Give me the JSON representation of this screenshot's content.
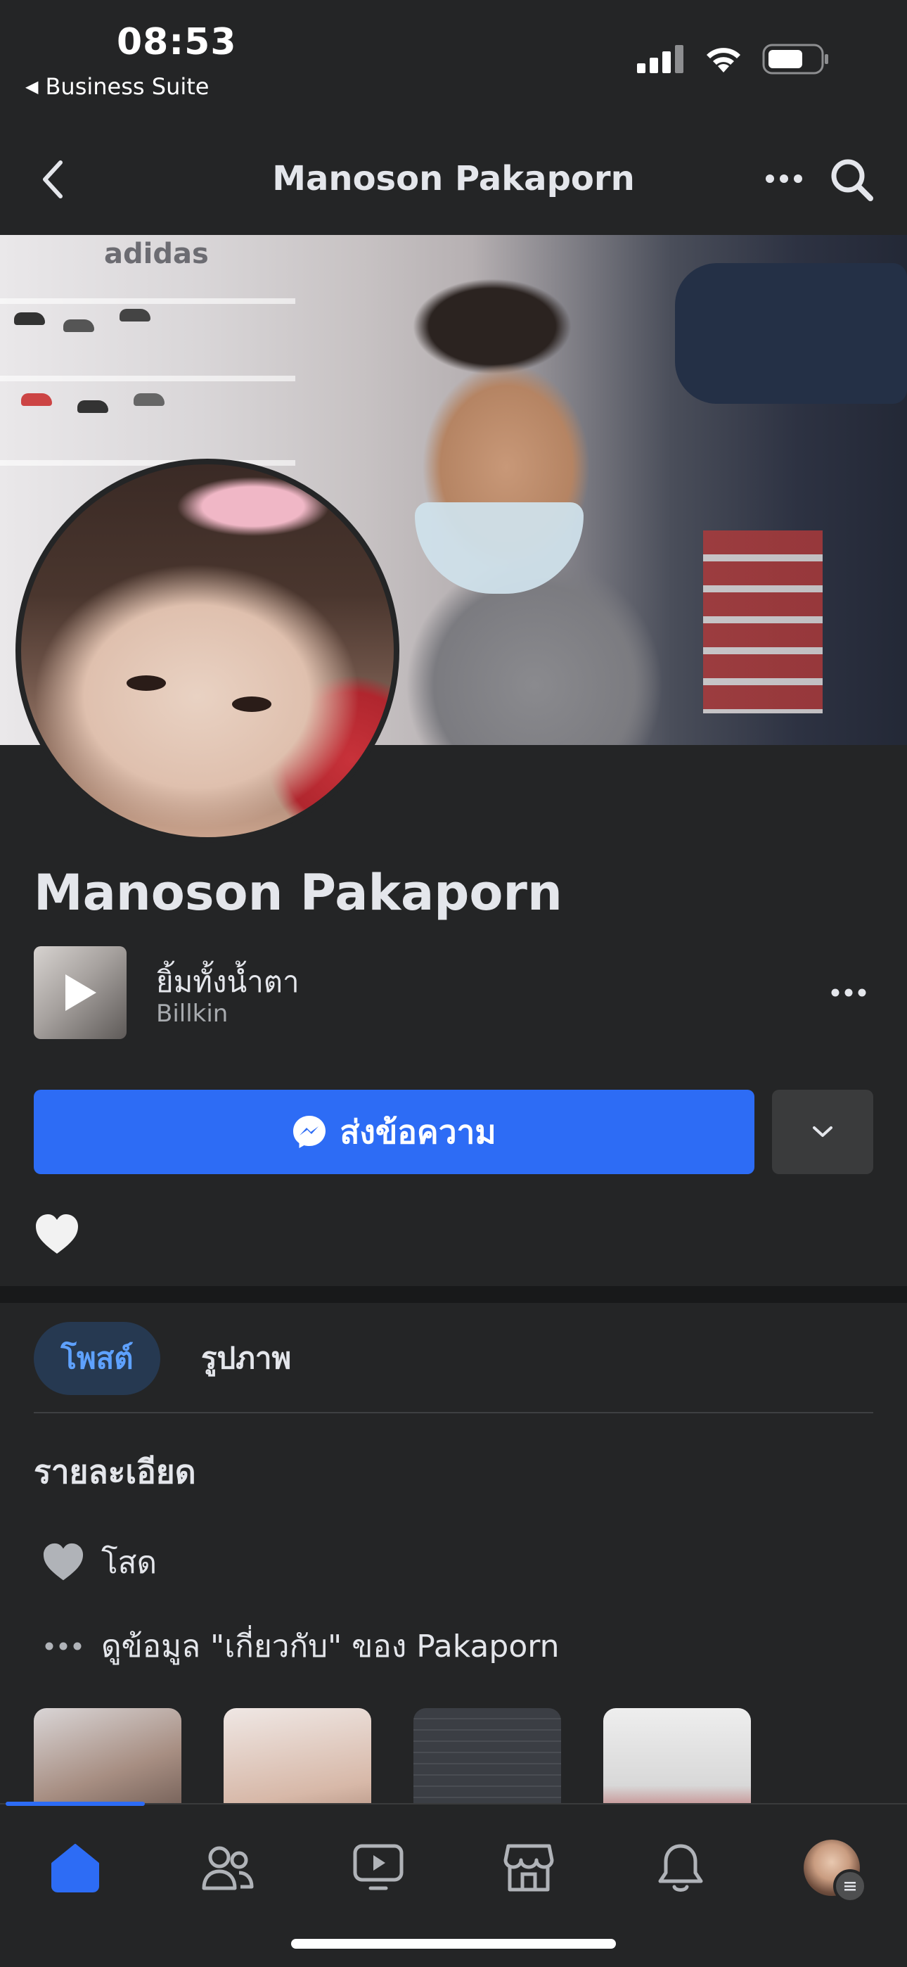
{
  "status_bar": {
    "time": "08:53",
    "back_app_label": "Business Suite"
  },
  "nav": {
    "title": "Manoson Pakaporn"
  },
  "profile": {
    "name": "Manoson Pakaporn",
    "cover_text": "adidas"
  },
  "music": {
    "title": "ยิ้มทั้งน้ำตา",
    "artist": "Billkin"
  },
  "actions": {
    "message_label": "ส่งข้อความ"
  },
  "tabs": {
    "posts": "โพสต์",
    "photos": "รูปภาพ"
  },
  "details": {
    "heading": "รายละเอียด",
    "relationship": "โสด",
    "about_link": "ดูข้อมูล \"เกี่ยวกับ\" ของ Pakaporn"
  },
  "colors": {
    "background": "#242526",
    "primary_button": "#2d6cf5",
    "active_tab_bg": "#263951",
    "active_tab_text": "#5ea1ff",
    "text": "#e4e6eb"
  },
  "bottom_nav": {
    "items": [
      "home-icon",
      "friends-icon",
      "video-icon",
      "marketplace-icon",
      "notifications-icon",
      "menu-avatar"
    ],
    "active": "home-icon"
  }
}
